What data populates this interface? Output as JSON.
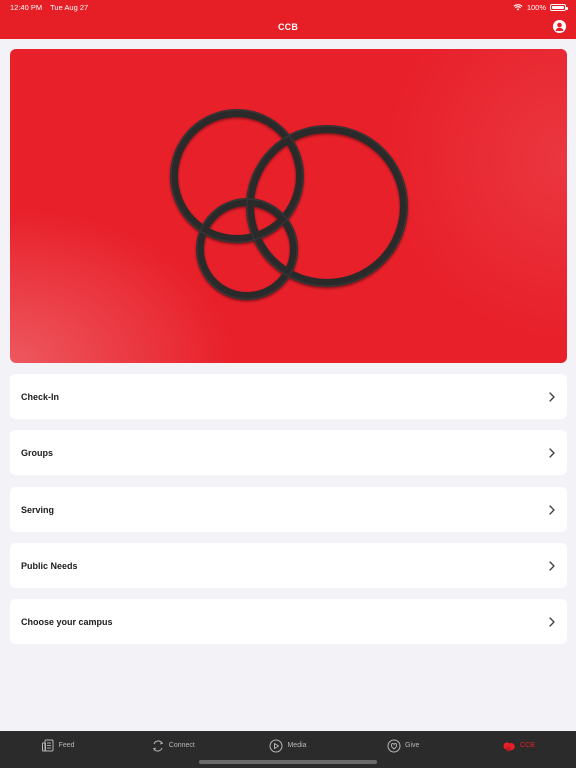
{
  "status": {
    "time": "12:40 PM",
    "date": "Tue Aug 27",
    "battery": "100%",
    "battery_level": 1.0
  },
  "nav": {
    "title": "CCB"
  },
  "menu": [
    {
      "label": "Check-In"
    },
    {
      "label": "Groups"
    },
    {
      "label": "Serving"
    },
    {
      "label": "Public Needs"
    },
    {
      "label": "Choose your campus"
    }
  ],
  "tabs": [
    {
      "label": "Feed",
      "icon": "feed-icon"
    },
    {
      "label": "Connect",
      "icon": "connect-icon"
    },
    {
      "label": "Media",
      "icon": "play-circle-icon"
    },
    {
      "label": "Give",
      "icon": "heart-circle-icon"
    },
    {
      "label": "CCB",
      "icon": "ccb-logo-icon",
      "active": true
    }
  ],
  "colors": {
    "accent": "#e61f26",
    "tab_bar": "#2b2b2b",
    "background": "#f2f2f7"
  }
}
